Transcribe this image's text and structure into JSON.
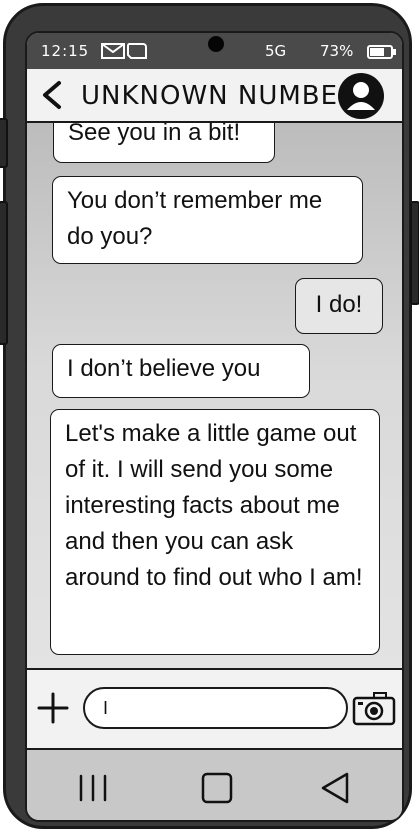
{
  "status_bar": {
    "time": "12:15",
    "network": "5G",
    "battery": "73%",
    "icons": [
      "mail-icon",
      "message-icon",
      "battery-icon"
    ]
  },
  "header": {
    "title": "UNKNOWN NUMBER",
    "icons": [
      "back-arrow-icon",
      "contact-avatar-icon"
    ]
  },
  "messages": [
    {
      "direction": "received",
      "text": "See you in a bit!"
    },
    {
      "direction": "received",
      "text": "You don’t remember me do you?"
    },
    {
      "direction": "sent",
      "text": "I do!"
    },
    {
      "direction": "received",
      "text": "I don’t believe you"
    },
    {
      "direction": "received",
      "text": "Let's make a little game out of it. I will send you some interesting facts about me and then you can ask around to find out who I am!"
    }
  ],
  "composer": {
    "value": "I",
    "icons": [
      "plus-icon",
      "camera-icon"
    ]
  },
  "nav": {
    "icons": [
      "recent-apps-icon",
      "home-icon",
      "back-icon"
    ]
  },
  "colors": {
    "phone_body": "#3a3a3a",
    "status_bar": "#4a4a4a",
    "bubble_received": "#ffffff",
    "bubble_sent": "#e6e6e6",
    "nav_bar": "#c8c8c8"
  }
}
